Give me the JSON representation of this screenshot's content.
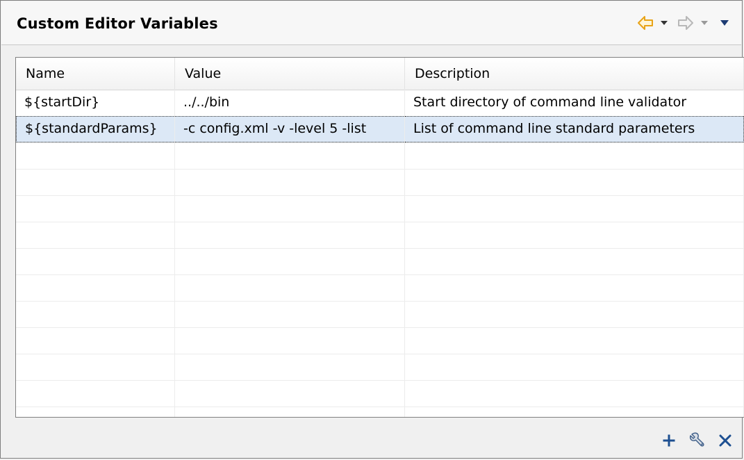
{
  "panel": {
    "title": "Custom Editor Variables",
    "nav": {
      "back_icon": "back-arrow-icon",
      "forward_icon": "forward-arrow-icon",
      "menu_icon": "view-menu-icon",
      "accent": "#e8a317"
    }
  },
  "table": {
    "columns": [
      "Name",
      "Value",
      "Description"
    ],
    "rows": [
      {
        "name": "${startDir}",
        "value": "../../bin",
        "description": "Start directory of command line validator"
      },
      {
        "name": "${standardParams}",
        "value": "-c config.xml -v -level 5 -list",
        "description": "List of command line standard parameters",
        "selected": true
      }
    ],
    "selection_color": "#dce8f6"
  },
  "actions": {
    "add_icon": "plus-icon",
    "edit_icon": "wrench-icon",
    "remove_icon": "close-icon",
    "icon_color": "#1d4f91"
  }
}
